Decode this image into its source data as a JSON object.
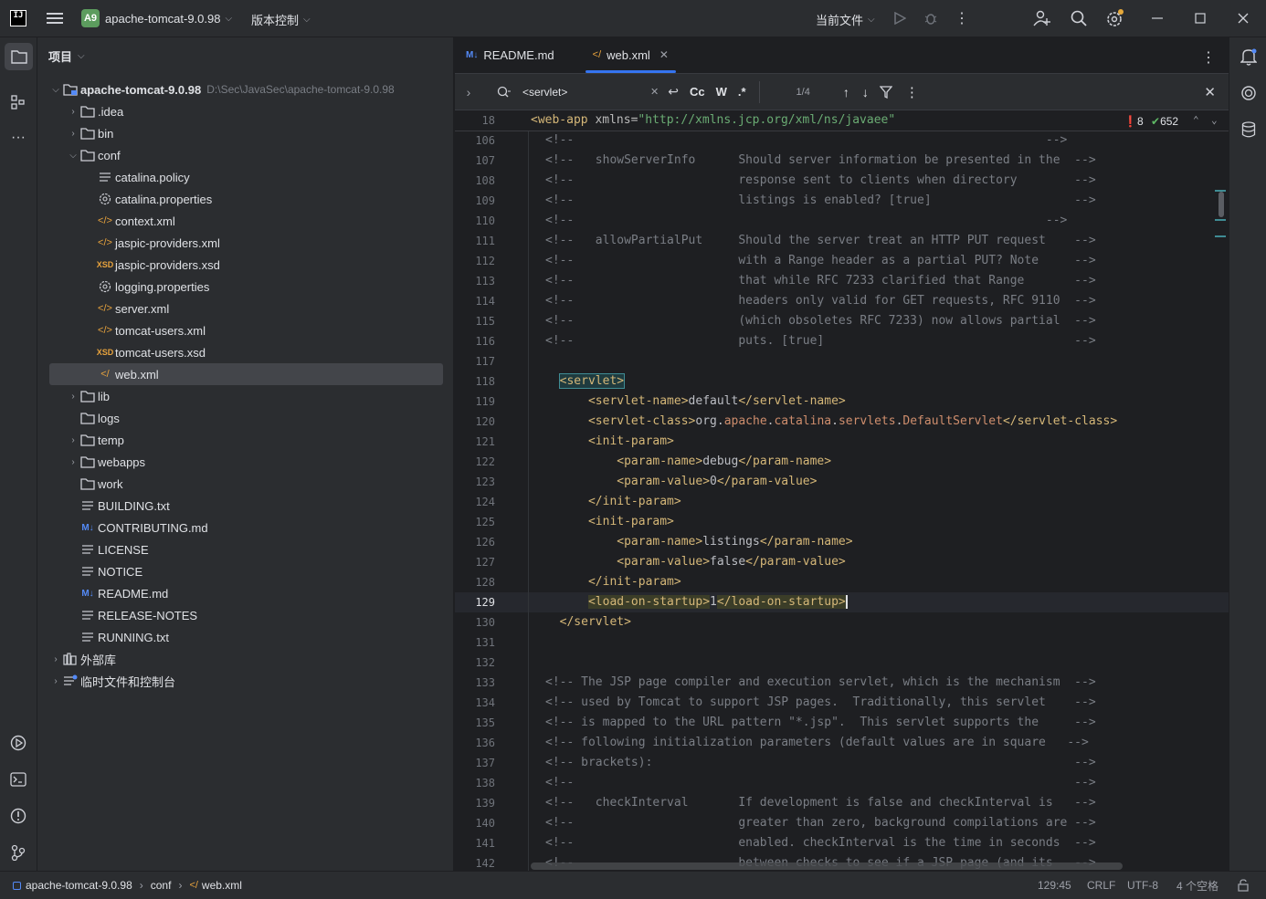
{
  "titlebar": {
    "logo": "IJ",
    "project_badge": "A9",
    "project_name": "apache-tomcat-9.0.98",
    "vcs": "版本控制",
    "run_config": "当前文件"
  },
  "project_panel": {
    "title": "项目",
    "tree": [
      {
        "label": "apache-tomcat-9.0.98",
        "path": "D:\\Sec\\JavaSec\\apache-tomcat-9.0.98",
        "indent": 0,
        "arrow": "▾",
        "icon": "module-icon",
        "bold": true
      },
      {
        "label": ".idea",
        "indent": 1,
        "arrow": "›",
        "icon": "folder-icon"
      },
      {
        "label": "bin",
        "indent": 1,
        "arrow": "›",
        "icon": "folder-icon"
      },
      {
        "label": "conf",
        "indent": 1,
        "arrow": "▾",
        "icon": "folder-icon"
      },
      {
        "label": "catalina.policy",
        "indent": 2,
        "arrow": "",
        "icon": "text-file-icon"
      },
      {
        "label": "catalina.properties",
        "indent": 2,
        "arrow": "",
        "icon": "properties-file-icon"
      },
      {
        "label": "context.xml",
        "indent": 2,
        "arrow": "",
        "icon": "xml-file-icon"
      },
      {
        "label": "jaspic-providers.xml",
        "indent": 2,
        "arrow": "",
        "icon": "xml-file-icon"
      },
      {
        "label": "jaspic-providers.xsd",
        "indent": 2,
        "arrow": "",
        "icon": "xsd-file-icon"
      },
      {
        "label": "logging.properties",
        "indent": 2,
        "arrow": "",
        "icon": "properties-file-icon"
      },
      {
        "label": "server.xml",
        "indent": 2,
        "arrow": "",
        "icon": "xml-file-icon"
      },
      {
        "label": "tomcat-users.xml",
        "indent": 2,
        "arrow": "",
        "icon": "xml-file-icon"
      },
      {
        "label": "tomcat-users.xsd",
        "indent": 2,
        "arrow": "",
        "icon": "xsd-file-icon"
      },
      {
        "label": "web.xml",
        "indent": 2,
        "arrow": "",
        "icon": "webxml-file-icon",
        "selected": true
      },
      {
        "label": "lib",
        "indent": 1,
        "arrow": "›",
        "icon": "folder-icon"
      },
      {
        "label": "logs",
        "indent": 1,
        "arrow": "",
        "icon": "folder-icon"
      },
      {
        "label": "temp",
        "indent": 1,
        "arrow": "›",
        "icon": "folder-icon"
      },
      {
        "label": "webapps",
        "indent": 1,
        "arrow": "›",
        "icon": "folder-icon"
      },
      {
        "label": "work",
        "indent": 1,
        "arrow": "",
        "icon": "folder-icon"
      },
      {
        "label": "BUILDING.txt",
        "indent": 1,
        "arrow": "",
        "icon": "text-file-icon"
      },
      {
        "label": "CONTRIBUTING.md",
        "indent": 1,
        "arrow": "",
        "icon": "markdown-file-icon"
      },
      {
        "label": "LICENSE",
        "indent": 1,
        "arrow": "",
        "icon": "text-file-icon"
      },
      {
        "label": "NOTICE",
        "indent": 1,
        "arrow": "",
        "icon": "text-file-icon"
      },
      {
        "label": "README.md",
        "indent": 1,
        "arrow": "",
        "icon": "markdown-file-icon"
      },
      {
        "label": "RELEASE-NOTES",
        "indent": 1,
        "arrow": "",
        "icon": "text-file-icon"
      },
      {
        "label": "RUNNING.txt",
        "indent": 1,
        "arrow": "",
        "icon": "text-file-icon"
      },
      {
        "label": "外部库",
        "indent": 0,
        "arrow": "›",
        "icon": "library-icon"
      },
      {
        "label": "临时文件和控制台",
        "indent": 0,
        "arrow": "›",
        "icon": "scratch-icon"
      }
    ]
  },
  "editor": {
    "tabs": [
      {
        "label": "README.md",
        "icon": "markdown-file-icon",
        "active": false
      },
      {
        "label": "web.xml",
        "icon": "webxml-file-icon",
        "active": true
      }
    ],
    "find": {
      "query": "<servlet>",
      "match_case": "Cc",
      "words": "W",
      "regex": ".*",
      "counter": "1/4"
    },
    "sticky_line_no": "18",
    "sticky_line": "<web-app xmlns=\"http://xmlns.jcp.org/xml/ns/javaee\"",
    "errors": "8",
    "warnings": "652",
    "lines": [
      {
        "n": "106",
        "t": "<!--                                                                  -->"
      },
      {
        "n": "107",
        "t": "<!--   showServerInfo      Should server information be presented in the  -->"
      },
      {
        "n": "108",
        "t": "<!--                       response sent to clients when directory        -->"
      },
      {
        "n": "109",
        "t": "<!--                       listings is enabled? [true]                    -->"
      },
      {
        "n": "110",
        "t": "<!--                                                                  -->"
      },
      {
        "n": "111",
        "t": "<!--   allowPartialPut     Should the server treat an HTTP PUT request    -->"
      },
      {
        "n": "112",
        "t": "<!--                       with a Range header as a partial PUT? Note     -->"
      },
      {
        "n": "113",
        "t": "<!--                       that while RFC 7233 clarified that Range       -->"
      },
      {
        "n": "114",
        "t": "<!--                       headers only valid for GET requests, RFC 9110  -->"
      },
      {
        "n": "115",
        "t": "<!--                       (which obsoletes RFC 7233) now allows partial  -->"
      },
      {
        "n": "116",
        "t": "<!--                       puts. [true]                                   -->"
      },
      {
        "n": "117",
        "t": ""
      },
      {
        "n": "118",
        "t": "  <servlet>"
      },
      {
        "n": "119",
        "t": "      <servlet-name>default</servlet-name>"
      },
      {
        "n": "120",
        "t": "      <servlet-class>org.apache.catalina.servlets.DefaultServlet</servlet-class>"
      },
      {
        "n": "121",
        "t": "      <init-param>"
      },
      {
        "n": "122",
        "t": "          <param-name>debug</param-name>"
      },
      {
        "n": "123",
        "t": "          <param-value>0</param-value>"
      },
      {
        "n": "124",
        "t": "      </init-param>"
      },
      {
        "n": "125",
        "t": "      <init-param>"
      },
      {
        "n": "126",
        "t": "          <param-name>listings</param-name>"
      },
      {
        "n": "127",
        "t": "          <param-value>false</param-value>"
      },
      {
        "n": "128",
        "t": "      </init-param>"
      },
      {
        "n": "129",
        "t": "      <load-on-startup>1</load-on-startup>"
      },
      {
        "n": "130",
        "t": "  </servlet>"
      },
      {
        "n": "131",
        "t": ""
      },
      {
        "n": "132",
        "t": ""
      },
      {
        "n": "133",
        "t": "<!-- The JSP page compiler and execution servlet, which is the mechanism  -->"
      },
      {
        "n": "134",
        "t": "<!-- used by Tomcat to support JSP pages.  Traditionally, this servlet    -->"
      },
      {
        "n": "135",
        "t": "<!-- is mapped to the URL pattern \"*.jsp\".  This servlet supports the     -->"
      },
      {
        "n": "136",
        "t": "<!-- following initialization parameters (default values are in square   -->"
      },
      {
        "n": "137",
        "t": "<!-- brackets):                                                           -->"
      },
      {
        "n": "138",
        "t": "<!--                                                                      -->"
      },
      {
        "n": "139",
        "t": "<!--   checkInterval       If development is false and checkInterval is   -->"
      },
      {
        "n": "140",
        "t": "<!--                       greater than zero, background compilations are -->"
      },
      {
        "n": "141",
        "t": "<!--                       enabled. checkInterval is the time in seconds  -->"
      },
      {
        "n": "142",
        "t": "<!--                       between checks to see if a JSP page (and its   -->"
      }
    ]
  },
  "statusbar": {
    "crumbs": [
      "apache-tomcat-9.0.98",
      "conf",
      "web.xml"
    ],
    "position": "129:45",
    "line_sep": "CRLF",
    "encoding": "UTF-8",
    "indent": "4 个空格"
  }
}
